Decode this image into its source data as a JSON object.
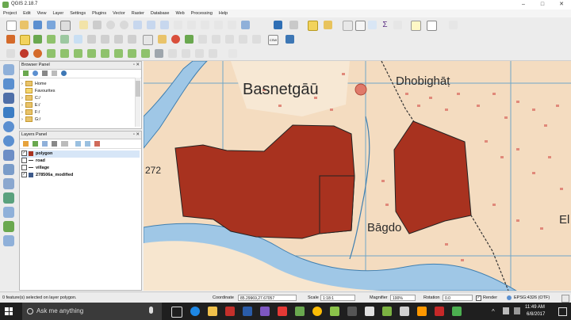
{
  "window": {
    "title": "QGIS 2.18.7"
  },
  "menu": [
    "Project",
    "Edit",
    "View",
    "Layer",
    "Settings",
    "Plugins",
    "Vector",
    "Raster",
    "Database",
    "Web",
    "Processing",
    "Help"
  ],
  "browser_panel": {
    "title": "Browser Panel",
    "items": [
      "Home",
      "Favourites",
      "C:/",
      "E:/",
      "F:/",
      "G:/"
    ]
  },
  "layers_panel": {
    "title": "Layers Panel",
    "layers": [
      {
        "name": "polygon",
        "checked": true,
        "type": "polygon"
      },
      {
        "name": "road",
        "checked": false,
        "type": "line"
      },
      {
        "name": "village",
        "checked": false,
        "type": "line"
      },
      {
        "name": "278506a_modified",
        "checked": true,
        "type": "raster"
      }
    ]
  },
  "map_labels": {
    "place1": "Basnetgāū",
    "place2": "Dhobighāṭ",
    "place3": "Bāgdo",
    "place4": "El",
    "spot": "272"
  },
  "colors": {
    "polygon_fill": "#a8321f",
    "map_bg": "#f4dcc0",
    "river": "#9fc7e6"
  },
  "status": {
    "message": "0 feature(s) selected on layer polygon.",
    "coordinate_label": "Coordinate",
    "coordinate": "85.29969,27.67057",
    "scale_label": "Scale",
    "scale": "1:18:1",
    "magnifier_label": "Magnifier",
    "magnifier": "100%",
    "rotation_label": "Rotation",
    "rotation": "0.0",
    "render_label": "Render",
    "crs": "EPSG:4326 (OTF)"
  },
  "taskbar": {
    "search_placeholder": "Ask me anything",
    "time": "11:49 AM",
    "date": "6/8/2017"
  }
}
